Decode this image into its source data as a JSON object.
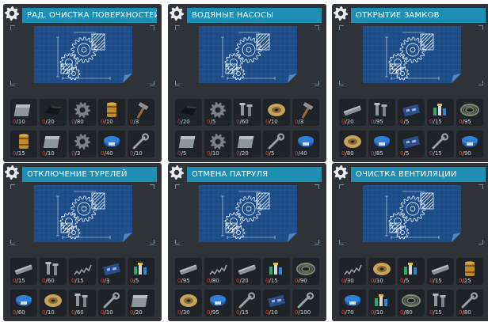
{
  "colors": {
    "title_bar": "#1e8fb4",
    "panel_bg": "#2f3337",
    "slot_bg": "#1f2226",
    "blueprint": "#1f4f8a",
    "have_qty": "#e23b2c"
  },
  "panels": [
    {
      "title": "РАД. ОЧИСТКА ПОВЕРХНОСТЕЙ",
      "items": [
        {
          "icon": "metal-sheet-icon",
          "have": "0",
          "need": "10"
        },
        {
          "icon": "tarp-icon",
          "have": "0",
          "need": "20"
        },
        {
          "icon": "gear-icon",
          "have": "0",
          "need": "80"
        },
        {
          "icon": "barrel-icon",
          "have": "0",
          "need": "10"
        },
        {
          "icon": "hammer-icon",
          "have": "0",
          "need": "3"
        },
        {
          "icon": "barrel-icon",
          "have": "0",
          "need": "15"
        },
        {
          "icon": "metal-sheet-icon",
          "have": "0",
          "need": "10"
        },
        {
          "icon": "gear-icon",
          "have": "0",
          "need": "3"
        },
        {
          "icon": "blue-drum-icon",
          "have": "0",
          "need": "40"
        },
        {
          "icon": "wrench-icon",
          "have": "0",
          "need": "10"
        }
      ]
    },
    {
      "title": "ВОДЯНЫЕ НАСОСЫ",
      "items": [
        {
          "icon": "tarp-icon",
          "have": "0",
          "need": "20"
        },
        {
          "icon": "gear-icon",
          "have": "0",
          "need": "5"
        },
        {
          "icon": "bolts-icon",
          "have": "0",
          "need": "60"
        },
        {
          "icon": "rope-icon",
          "have": "0",
          "need": "10"
        },
        {
          "icon": "hammer-icon",
          "have": "0",
          "need": "3"
        },
        {
          "icon": "metal-sheet-icon",
          "have": "0",
          "need": "5"
        },
        {
          "icon": "gear-icon",
          "have": "0",
          "need": "10"
        },
        {
          "icon": "metal-sheet-icon",
          "have": "0",
          "need": "20"
        },
        {
          "icon": "wrench-icon",
          "have": "0",
          "need": "5"
        },
        {
          "icon": "blue-drum-icon",
          "have": "0",
          "need": "40"
        }
      ]
    },
    {
      "title": "ОТКРЫТИЕ ЗАМКОВ",
      "items": [
        {
          "icon": "pipe-icon",
          "have": "0",
          "need": "20"
        },
        {
          "icon": "bolts-icon",
          "have": "0",
          "need": "95"
        },
        {
          "icon": "circuit-board-icon",
          "have": "0",
          "need": "5"
        },
        {
          "icon": "electronics-icon",
          "have": "0",
          "need": "15"
        },
        {
          "icon": "wire-coil-icon",
          "have": "0",
          "need": "95"
        },
        {
          "icon": "rope-icon",
          "have": "0",
          "need": "80"
        },
        {
          "icon": "blue-drum-icon",
          "have": "0",
          "need": "85"
        },
        {
          "icon": "circuit-board-icon",
          "have": "0",
          "need": "5"
        },
        {
          "icon": "wrench-icon",
          "have": "0",
          "need": "15"
        },
        {
          "icon": "blue-drum-icon",
          "have": "0",
          "need": "90"
        }
      ]
    },
    {
      "title": "ОТКЛЮЧЕНИЕ ТУРЕЛЕЙ",
      "items": [
        {
          "icon": "pipe-icon",
          "have": "0",
          "need": "15"
        },
        {
          "icon": "bolts-icon",
          "have": "0",
          "need": "60"
        },
        {
          "icon": "spring-icon",
          "have": "0",
          "need": "15"
        },
        {
          "icon": "circuit-board-icon",
          "have": "0",
          "need": "3"
        },
        {
          "icon": "electronics-icon",
          "have": "0",
          "need": "5"
        },
        {
          "icon": "blue-drum-icon",
          "have": "0",
          "need": "60"
        },
        {
          "icon": "rope-icon",
          "have": "0",
          "need": "10"
        },
        {
          "icon": "bolts-icon",
          "have": "0",
          "need": "60"
        },
        {
          "icon": "wrench-icon",
          "have": "0",
          "need": "10"
        },
        {
          "icon": "metal-sheet-icon",
          "have": "0",
          "need": "20"
        }
      ]
    },
    {
      "title": "ОТМЕНА ПАТРУЛЯ",
      "items": [
        {
          "icon": "pipe-icon",
          "have": "0",
          "need": "95"
        },
        {
          "icon": "spring-icon",
          "have": "0",
          "need": "80"
        },
        {
          "icon": "pipe-icon",
          "have": "0",
          "need": "20"
        },
        {
          "icon": "electronics-icon",
          "have": "0",
          "need": "15"
        },
        {
          "icon": "wire-coil-icon",
          "have": "0",
          "need": "90"
        },
        {
          "icon": "rope-icon",
          "have": "0",
          "need": "30"
        },
        {
          "icon": "blue-drum-icon",
          "have": "0",
          "need": "95"
        },
        {
          "icon": "wrench-icon",
          "have": "0",
          "need": "15"
        },
        {
          "icon": "circuit-board-icon",
          "have": "0",
          "need": "10"
        },
        {
          "icon": "wrench-icon",
          "have": "0",
          "need": "100"
        }
      ]
    },
    {
      "title": "ОЧИСТКА ВЕНТИЛЯЦИИ",
      "items": [
        {
          "icon": "spring-icon",
          "have": "0",
          "need": "30"
        },
        {
          "icon": "rope-icon",
          "have": "0",
          "need": "10"
        },
        {
          "icon": "electronics-icon",
          "have": "0",
          "need": "5"
        },
        {
          "icon": "pipe-icon",
          "have": "0",
          "need": "15"
        },
        {
          "icon": "barrel-icon",
          "have": "0",
          "need": "25"
        },
        {
          "icon": "blue-drum-icon",
          "have": "0",
          "need": "70"
        },
        {
          "icon": "electronics-icon",
          "have": "0",
          "need": "10"
        },
        {
          "icon": "wire-coil-icon",
          "have": "0",
          "need": "80"
        },
        {
          "icon": "bolts-icon",
          "have": "0",
          "need": "15"
        },
        {
          "icon": "wrench-icon",
          "have": "0",
          "need": "80"
        }
      ]
    }
  ]
}
